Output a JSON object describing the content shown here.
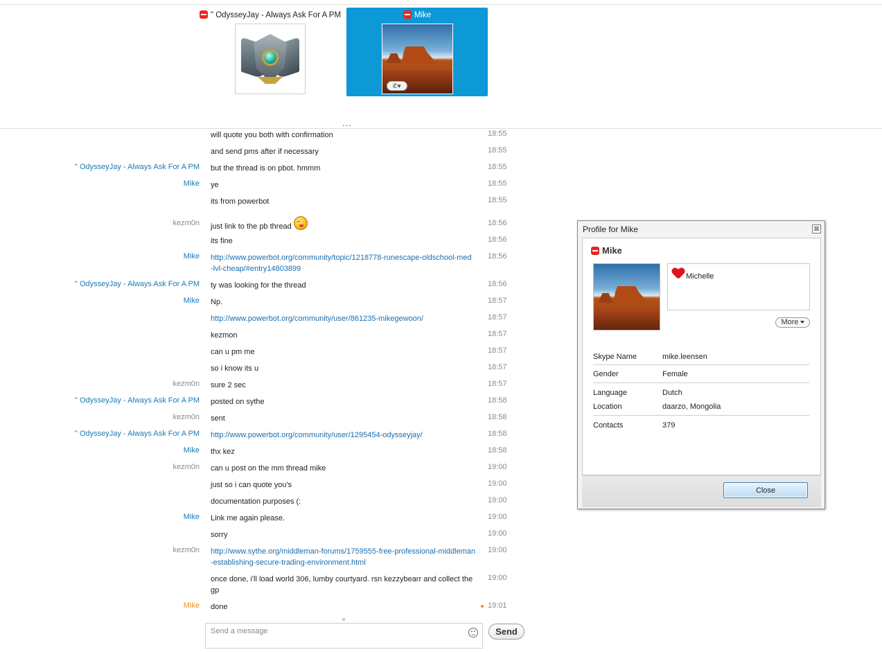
{
  "participants": [
    {
      "name": "\" OdysseyJay - Always Ask For A PM",
      "selected": false,
      "avatar": "silver-badge-avatar"
    },
    {
      "name": "Mike",
      "selected": true,
      "avatar": "desert-butte-avatar",
      "call_button_icon": "skype-call-icon"
    }
  ],
  "more_indicator": "...",
  "colors": {
    "accent": "#0d99d6",
    "link": "#1a6eb0",
    "sender_blue": "#1a7ab5",
    "sender_gray": "#8a8a8a",
    "unread": "#f0901a",
    "status_red": "#e8281e"
  },
  "messages": [
    {
      "sender": "",
      "text": "will quote you both with confirmation",
      "time": "18:55"
    },
    {
      "sender": "",
      "text": "and send pms after if necessary",
      "time": "18:55"
    },
    {
      "sender": "\" OdysseyJay - Always Ask For A PM",
      "text": "but the thread is on pbot. hmmm",
      "time": "18:55"
    },
    {
      "sender": "Mike",
      "text": "ye",
      "time": "18:55"
    },
    {
      "sender": "",
      "text": "its from powerbot",
      "time": "18:55"
    },
    {
      "sender": "kezm0n",
      "text": "just link to the pb thread",
      "time": "18:56",
      "emoji": "tongue-smiley-icon"
    },
    {
      "sender": "",
      "text": "its fine",
      "time": "18:56"
    },
    {
      "sender": "Mike",
      "text_lines": [
        "http://www.powerbot.org/community/topic/1218778-runescape-oldschool-med",
        "-lvl-cheap/#entry14803899"
      ],
      "time": "18:56"
    },
    {
      "sender": "\" OdysseyJay - Always Ask For A PM",
      "text": "ty was looking for the thread",
      "time": "18:56"
    },
    {
      "sender": "Mike",
      "text": "Np.",
      "time": "18:57"
    },
    {
      "sender": "",
      "text": "http://www.powerbot.org/community/user/861235-mikegewoon/",
      "time": "18:57"
    },
    {
      "sender": "",
      "text": "kezmon",
      "time": "18:57"
    },
    {
      "sender": "",
      "text": "can u pm me",
      "time": "18:57"
    },
    {
      "sender": "",
      "text": "so i know its u",
      "time": "18:57"
    },
    {
      "sender": "kezm0n",
      "text": "sure 2 sec",
      "time": "18:57"
    },
    {
      "sender": "\" OdysseyJay - Always Ask For A PM",
      "text": "posted on sythe",
      "time": "18:58"
    },
    {
      "sender": "kezm0n",
      "text": "sent",
      "time": "18:58"
    },
    {
      "sender": "\" OdysseyJay - Always Ask For A PM",
      "text": "http://www.powerbot.org/community/user/1295454-odysseyjay/",
      "time": "18:58"
    },
    {
      "sender": "Mike",
      "text": "thx kez",
      "time": "18:58"
    },
    {
      "sender": "kezm0n",
      "text": "can u post on the mm thread mike",
      "time": "19:00"
    },
    {
      "sender": "",
      "text": "just so i can quote you's",
      "time": "19:00"
    },
    {
      "sender": "",
      "text": "documentation purposes (:",
      "time": "19:00"
    },
    {
      "sender": "Mike",
      "text": "Link me again please.",
      "time": "19:00"
    },
    {
      "sender": "",
      "text": "sorry",
      "time": "19:00"
    },
    {
      "sender": "kezm0n",
      "text_lines": [
        "http://www.sythe.org/middleman-forums/1759555-free-professional-middleman",
        "-establishing-secure-trading-environment.html"
      ],
      "time": "19:00"
    },
    {
      "sender": "",
      "text_lines": [
        "once done, i'll load world 306, lumby courtyard. rsn kezzybearr and collect the",
        "gp"
      ],
      "time": "19:00"
    },
    {
      "sender": "Mike",
      "text": "done",
      "time": "19:01",
      "unread": true
    }
  ],
  "composer": {
    "placeholder": "Send a message",
    "value": "",
    "emoji_icon": "smiley-icon",
    "send_label": "Send"
  },
  "profile": {
    "window_title": "Profile for Mike",
    "close_x": "⊠",
    "name": "Mike",
    "mood": "Michelle",
    "mood_icon": "heart-icon",
    "more_label": "More",
    "fields": [
      {
        "label": "Skype Name",
        "value": "mike.leensen"
      },
      {
        "label": "Gender",
        "value": "Female"
      },
      {
        "label": "Language",
        "value": "Dutch"
      },
      {
        "label": "Location",
        "value": "daarzo, Mongolia"
      },
      {
        "label": "Contacts",
        "value": "379"
      }
    ],
    "close_label": "Close"
  }
}
